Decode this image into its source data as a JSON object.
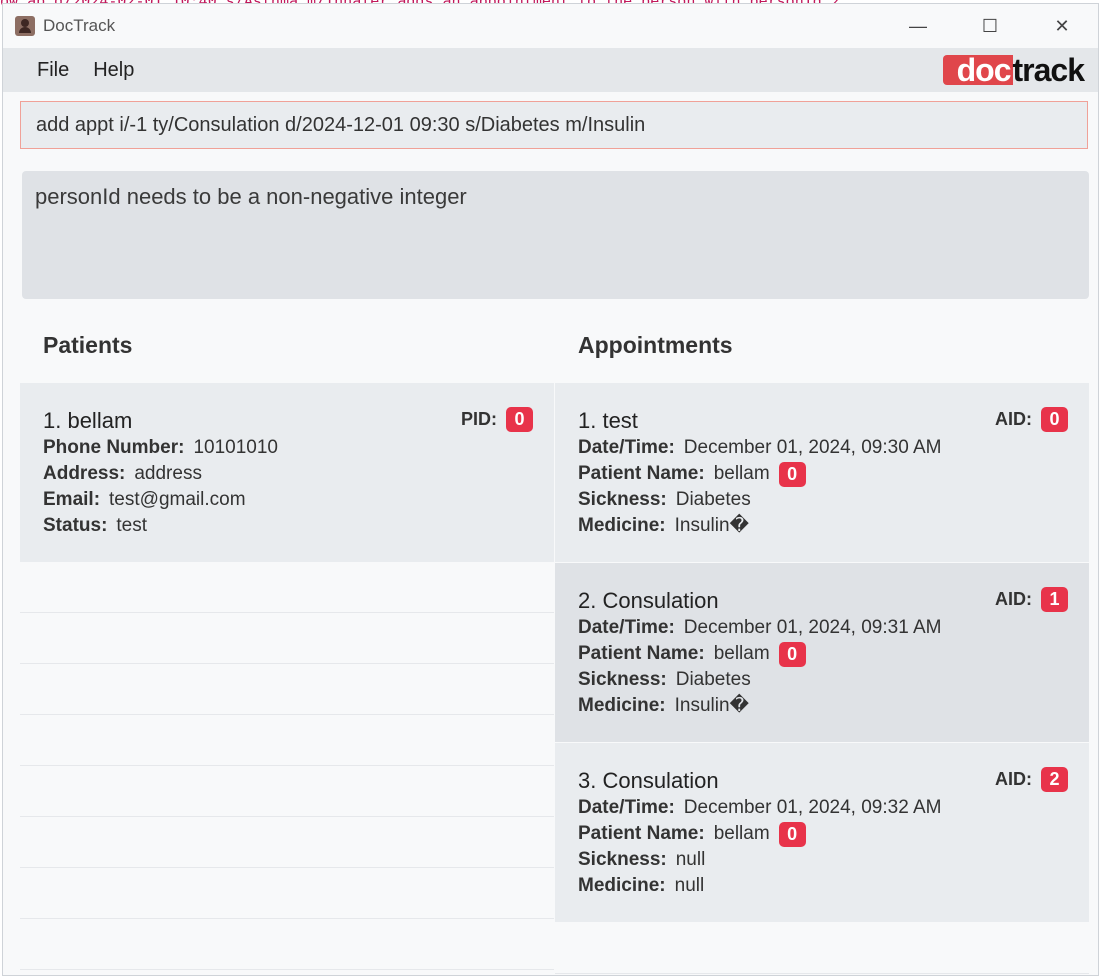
{
  "background_text": "ow ap d/2024-02-01 10:40 s/Asthma m/Inhaler  adds an appointment to the person with personId 2",
  "window": {
    "title": "DocTrack",
    "minimize": "—",
    "maximize": "☐",
    "close": "✕"
  },
  "menu": {
    "file": "File",
    "help": "Help"
  },
  "logo": {
    "part1": "doc",
    "part2": "track"
  },
  "command_input": {
    "value": "add appt i/-1 ty/Consulation d/2024-12-01 09:30 s/Diabetes m/Insulin"
  },
  "result": {
    "message": "personId needs to be a non-negative integer"
  },
  "patients": {
    "title": "Patients",
    "items": [
      {
        "name": "1. bellam",
        "pid_label": "PID:",
        "pid": "0",
        "phone_label": "Phone Number:",
        "phone": "10101010",
        "address_label": "Address:",
        "address": "address",
        "email_label": "Email:",
        "email": "test@gmail.com",
        "status_label": "Status:",
        "status": "test"
      }
    ]
  },
  "appointments": {
    "title": "Appointments",
    "items": [
      {
        "name": "1. test",
        "aid_label": "AID:",
        "aid": "0",
        "datetime_label": "Date/Time:",
        "datetime": "December 01, 2024, 09:30 AM",
        "patient_label": "Patient Name:",
        "patient": "bellam",
        "patient_id": "0",
        "sickness_label": "Sickness:",
        "sickness": "Diabetes",
        "medicine_label": "Medicine:",
        "medicine": "Insulin�"
      },
      {
        "name": "2. Consulation",
        "aid_label": "AID:",
        "aid": "1",
        "datetime_label": "Date/Time:",
        "datetime": "December 01, 2024, 09:31 AM",
        "patient_label": "Patient Name:",
        "patient": "bellam",
        "patient_id": "0",
        "sickness_label": "Sickness:",
        "sickness": "Diabetes",
        "medicine_label": "Medicine:",
        "medicine": "Insulin�"
      },
      {
        "name": "3. Consulation",
        "aid_label": "AID:",
        "aid": "2",
        "datetime_label": "Date/Time:",
        "datetime": "December 01, 2024, 09:32 AM",
        "patient_label": "Patient Name:",
        "patient": "bellam",
        "patient_id": "0",
        "sickness_label": "Sickness:",
        "sickness": "null",
        "medicine_label": "Medicine:",
        "medicine": "null"
      }
    ]
  },
  "colors": {
    "badge": "#e8334a",
    "logo_red": "#e0464b",
    "input_border": "#f0a198"
  }
}
